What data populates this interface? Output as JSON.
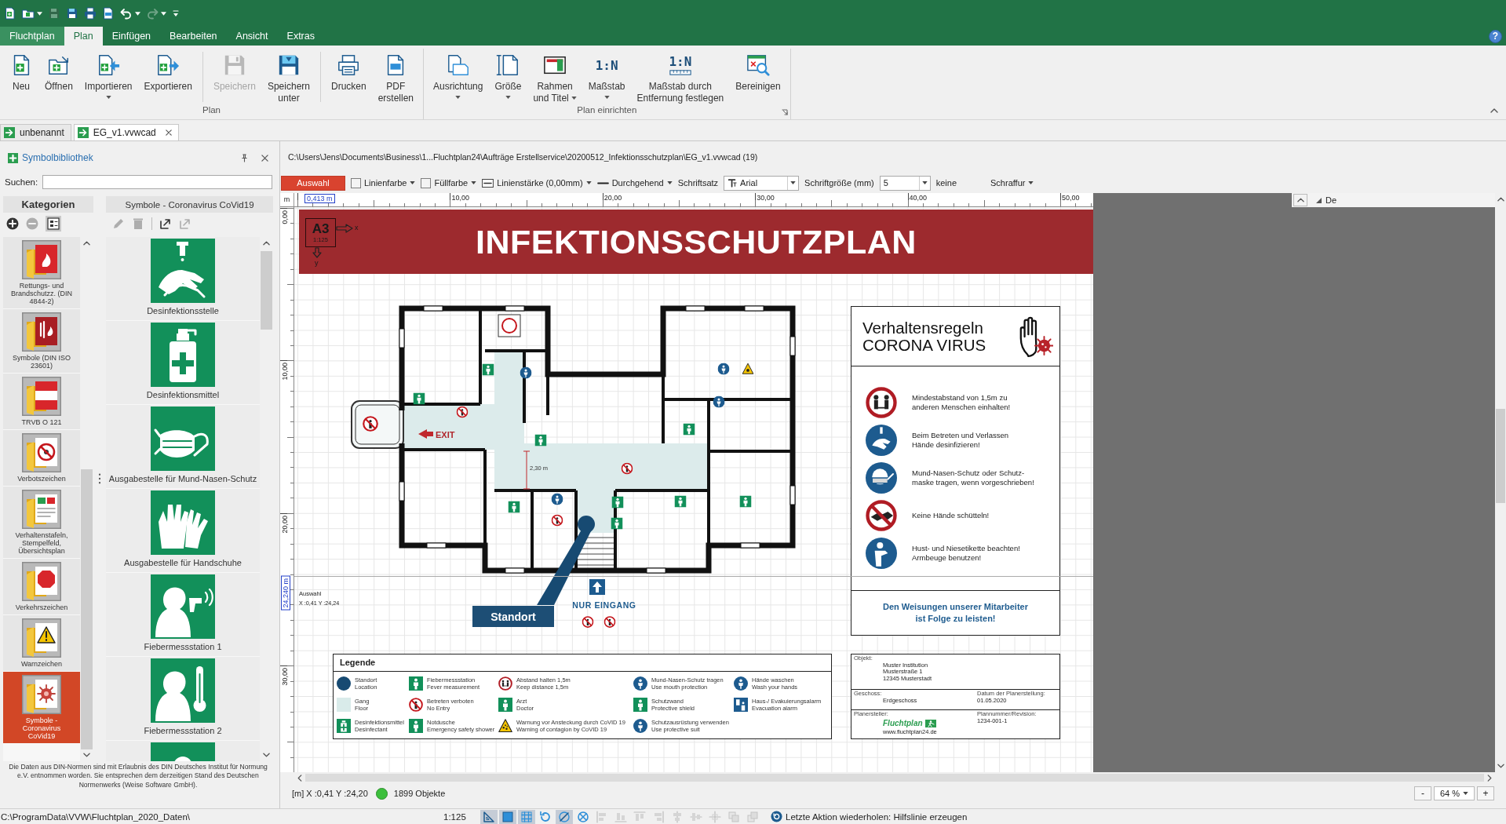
{
  "quick_access": [
    {
      "kind": "new",
      "disabled": false,
      "dropdown": false
    },
    {
      "kind": "open",
      "disabled": false,
      "dropdown": true
    },
    {
      "kind": "save",
      "disabled": true,
      "dropdown": false
    },
    {
      "kind": "save-as",
      "disabled": false,
      "dropdown": false
    },
    {
      "kind": "print",
      "disabled": false,
      "dropdown": false
    },
    {
      "kind": "pdf",
      "disabled": false,
      "dropdown": false
    },
    {
      "kind": "undo",
      "disabled": false,
      "dropdown": true
    },
    {
      "kind": "redo",
      "disabled": true,
      "dropdown": true
    },
    {
      "kind": "customize",
      "disabled": false,
      "dropdown": false
    }
  ],
  "ribbon_tabs": [
    {
      "label": "Fluchtplan",
      "kind": "backstage",
      "selected": false
    },
    {
      "label": "Plan",
      "kind": "tab",
      "selected": true
    },
    {
      "label": "Einfügen",
      "kind": "tab",
      "selected": false
    },
    {
      "label": "Bearbeiten",
      "kind": "tab",
      "selected": false
    },
    {
      "label": "Ansicht",
      "kind": "tab",
      "selected": false
    },
    {
      "label": "Extras",
      "kind": "tab",
      "selected": false
    }
  ],
  "help": "?",
  "ribbon_groups": [
    {
      "label": "Plan",
      "launcher": false,
      "sections": [
        [
          {
            "label": "Neu",
            "kind": "new",
            "disabled": false,
            "dropdown": false
          },
          {
            "label": "Öffnen",
            "kind": "open",
            "disabled": false,
            "dropdown": false
          },
          {
            "label": "Importieren",
            "kind": "import",
            "disabled": false,
            "dropdown": true
          },
          {
            "label": "Exportieren",
            "kind": "export",
            "disabled": false,
            "dropdown": false
          }
        ],
        [
          {
            "label": "Speichern",
            "kind": "save",
            "disabled": true,
            "dropdown": false
          },
          {
            "label": "Speichern\nunter",
            "kind": "save-as",
            "disabled": false,
            "dropdown": false
          }
        ],
        [
          {
            "label": "Drucken",
            "kind": "print",
            "disabled": false,
            "dropdown": false
          },
          {
            "label": "PDF\nerstellen",
            "kind": "pdf",
            "disabled": false,
            "dropdown": false
          }
        ]
      ]
    },
    {
      "label": "Plan einrichten",
      "launcher": true,
      "sections": [
        [
          {
            "label": "Ausrichtung",
            "kind": "orientation",
            "disabled": false,
            "dropdown": true
          },
          {
            "label": "Größe",
            "kind": "size",
            "disabled": false,
            "dropdown": true
          },
          {
            "label": "Rahmen\nund Titel",
            "kind": "frame",
            "disabled": false,
            "dropdown": true
          },
          {
            "label": "Maßstab",
            "kind": "scale",
            "icon_text": "1:N",
            "disabled": false,
            "dropdown": true
          },
          {
            "label": "Maßstab durch\nEntfernung festlegen",
            "kind": "scale-distance",
            "icon_text": "1:N",
            "disabled": false,
            "dropdown": false
          },
          {
            "label": "Bereinigen",
            "kind": "clean",
            "disabled": false,
            "dropdown": false
          }
        ]
      ]
    }
  ],
  "document_tabs": [
    {
      "label": "unbenannt",
      "selected": false,
      "closable": false
    },
    {
      "label": "EG_v1.vvwcad",
      "selected": true,
      "closable": true
    }
  ],
  "library": {
    "title": "Symbolbibliothek",
    "search_label": "Suchen:",
    "categories_header": "Kategorien",
    "symbols_header": "Symbole - Coronavirus CoVid19",
    "category_tools": [
      {
        "kind": "add",
        "disabled": false,
        "on": false
      },
      {
        "kind": "remove",
        "disabled": true,
        "on": false
      },
      {
        "kind": "view",
        "disabled": false,
        "on": true
      }
    ],
    "symbol_tools": [
      {
        "kind": "edit",
        "disabled": true
      },
      {
        "kind": "delete",
        "disabled": true
      },
      {
        "kind": "export",
        "disabled": false
      },
      {
        "kind": "export",
        "disabled": true
      }
    ],
    "categories": [
      {
        "label": "Rettungs- und\nBrandschutzz. (DIN\n4844-2)",
        "kind": "fire",
        "selected": false
      },
      {
        "label": "Symbole (DIN ISO\n23601)",
        "kind": "fire-dark",
        "selected": false
      },
      {
        "label": "TRVB O 121",
        "kind": "trvb",
        "selected": false
      },
      {
        "label": "Verbotszeichen",
        "kind": "prohibition",
        "selected": false
      },
      {
        "label": "Verhaltenstafeln,\nStempelfeld,\nÜbersichtsplan",
        "kind": "board",
        "selected": false
      },
      {
        "label": "Verkehrszeichen",
        "kind": "stop",
        "selected": false
      },
      {
        "label": "Warnzeichen",
        "kind": "warning",
        "selected": false
      },
      {
        "label": "Symbole -\nCoronavirus\nCoVid19",
        "kind": "virus",
        "selected": true
      }
    ],
    "symbols": [
      {
        "label": "Desinfektionsstelle",
        "kind": "hands"
      },
      {
        "label": "Desinfektionsmittel",
        "kind": "bottle"
      },
      {
        "label": "Ausgabestelle für Mund-Nasen-Schutz",
        "kind": "mask"
      },
      {
        "label": "Ausgabestelle für Handschuhe",
        "kind": "gloves"
      },
      {
        "label": "Fiebermessstation 1",
        "kind": "fever-gun"
      },
      {
        "label": "Fiebermessstation 2",
        "kind": "thermometer"
      },
      {
        "kind": "person"
      }
    ],
    "notice": "Die Daten aus DIN-Normen sind mit Erlaubnis des DIN Deutsches Institut für Normung e.V. entnommen worden. Sie entsprechen dem derzeitigen Stand des Deutschen Normenwerks (Weise Software GmbH)."
  },
  "document": {
    "path": "C:\\Users\\Jens\\Documents\\Business\\1...Fluchtplan24\\Aufträge Erstellservice\\20200512_Infektionsschutzplan\\EG_v1.vvwcad (19)",
    "format_toolbar": [
      {
        "kind": "button",
        "label": "Auswahl",
        "selected": true
      },
      {
        "kind": "color",
        "label": "Linienfarbe"
      },
      {
        "kind": "color",
        "label": "Füllfarbe"
      },
      {
        "kind": "line-width",
        "label": "Linienstärke (0,00mm)"
      },
      {
        "kind": "line-style",
        "label": "Durchgehend"
      },
      {
        "kind": "label",
        "label": "Schriftsatz"
      },
      {
        "kind": "font",
        "value": "Arial"
      },
      {
        "kind": "label",
        "label": "Schriftgröße (mm)"
      },
      {
        "kind": "number",
        "value": "5"
      },
      {
        "kind": "label",
        "label": "keine"
      },
      {
        "kind": "dropdown",
        "label": "Schraffur"
      }
    ],
    "ruler": {
      "unit": "m",
      "x_cursor": "0,413 m",
      "x_ticks": [
        "10,00",
        "20,00",
        "30,00",
        "40,00",
        "50,00"
      ],
      "y_cursor": "24,240 m",
      "y_ticks": [
        "0,00",
        "10,00",
        "20,00",
        "30,00"
      ]
    },
    "dock_header": "De",
    "plan": {
      "paper": "A3",
      "scale": "1:125",
      "axis_labels": [
        "x",
        "y"
      ],
      "title": "INFEKTIONSSCHUTZPLAN",
      "floor_labels": {
        "exit": "EXIT",
        "dimension": "2,30 m",
        "location": "Standort",
        "entrance": "NUR EINGANG"
      },
      "cursor_tool": "Auswahl",
      "cursor_position": "X :0,41 Y :24,24",
      "rules_board": {
        "title": "Verhaltensregeln",
        "subtitle": "CORONA VIRUS",
        "rules": [
          {
            "kind": "distance",
            "text": "Mindestabstand von 1,5m zu\nanderen Menschen einhalten!"
          },
          {
            "kind": "hands",
            "text": "Beim Betreten und Verlassen\nHände desinfizieren!"
          },
          {
            "kind": "mask",
            "text": "Mund-Nasen-Schutz oder Schutz-\nmaske tragen, wenn vorgeschrieben!"
          },
          {
            "kind": "no-handshake",
            "text": "Keine Hände schütteln!"
          },
          {
            "kind": "cough",
            "text": "Hust- und Niesetikette beachten!\nArmbeuge benutzen!"
          }
        ],
        "footer": "Den Weisungen unserer Mitarbeiter\nist Folge zu leisten!"
      },
      "legend": {
        "title": "Legende",
        "items": [
          {
            "kind": "dot",
            "de": "Standort",
            "en": "Location"
          },
          {
            "kind": "swatch",
            "de": "Gang",
            "en": "Floor"
          },
          {
            "kind": "bottle",
            "de": "Desinfektionsmittel",
            "en": "Desinfectant"
          },
          {
            "kind": "safe",
            "de": "Fiebermessstation",
            "en": "Fever measurement"
          },
          {
            "kind": "prohibit",
            "de": "Betreten verboten",
            "en": "No Entry"
          },
          {
            "kind": "safe",
            "de": "Notdusche",
            "en": "Emergency safety shower"
          },
          {
            "kind": "distance",
            "de": "Abstand halten 1,5m",
            "en": "Keep distance 1,5m"
          },
          {
            "kind": "safe",
            "de": "Arzt",
            "en": "Doctor"
          },
          {
            "kind": "warning",
            "de": "Warnung vor Ansteckung durch CoVID 19",
            "en": "Warning of contagion by CoVID 19"
          },
          {
            "kind": "mandatory",
            "de": "Mund-Nasen-Schutz tragen",
            "en": "Use mouth protection"
          },
          {
            "kind": "safe",
            "de": "Schutzwand",
            "en": "Protective shield"
          },
          {
            "kind": "mandatory",
            "de": "Schutzausrüstung verwenden",
            "en": "Use protective suit"
          },
          {
            "kind": "mandatory",
            "de": "Hände waschen",
            "en": "Wash your hands"
          },
          {
            "kind": "alarm",
            "de": "Haus-/ Evakuierungsalarm",
            "en": "Evacuation alarm"
          }
        ]
      },
      "title_block": [
        [
          {
            "kind": "text",
            "label": "Objekt:",
            "value": "Muster Institution\nMusterstraße 1\n12345 Musterstadt"
          }
        ],
        [
          {
            "kind": "text",
            "label": "Geschoss:",
            "value": "Erdgeschoss"
          },
          {
            "kind": "text",
            "label": "Datum der Planerstellung:",
            "value": "01.05.2020"
          }
        ],
        [
          {
            "kind": "logo",
            "label": "Planersteller:",
            "value": "Fluchtplan",
            "url": "www.fluchtplan24.de"
          },
          {
            "kind": "text",
            "label": "Plannummer/Revision:",
            "value": "1234-001-1"
          }
        ]
      ]
    }
  },
  "status_line": {
    "coordinates": "[m] X :0,41 Y :24,20",
    "objects": "1899 Objekte",
    "zoom_out": "-",
    "zoom": "64 %",
    "zoom_in": "+"
  },
  "status_bar": {
    "path": "C:\\ProgramData\\VVW\\Fluchtplan_2020_Daten\\",
    "scale": "1:125",
    "tools": [
      {
        "kind": "triangle",
        "on": true,
        "disabled": false
      },
      {
        "kind": "square",
        "on": true,
        "disabled": false
      },
      {
        "kind": "grid",
        "on": true,
        "disabled": false
      },
      {
        "kind": "rotate",
        "on": false,
        "disabled": false
      },
      {
        "kind": "snap",
        "on": true,
        "disabled": false
      },
      {
        "kind": "cancel",
        "on": false,
        "disabled": false
      },
      {
        "kind": "align-left",
        "on": false,
        "disabled": true
      },
      {
        "kind": "align-bottom",
        "on": false,
        "disabled": true
      },
      {
        "kind": "align-top",
        "on": false,
        "disabled": true
      },
      {
        "kind": "align-right",
        "on": false,
        "disabled": true
      },
      {
        "kind": "center-h",
        "on": false,
        "disabled": true
      },
      {
        "kind": "center-v",
        "on": false,
        "disabled": true
      },
      {
        "kind": "center",
        "on": false,
        "disabled": true
      },
      {
        "kind": "same-width",
        "on": false,
        "disabled": true
      },
      {
        "kind": "same-height",
        "on": false,
        "disabled": true
      }
    ],
    "last_action": "Letzte Aktion wiederholen: Hilfslinie erzeugen"
  }
}
